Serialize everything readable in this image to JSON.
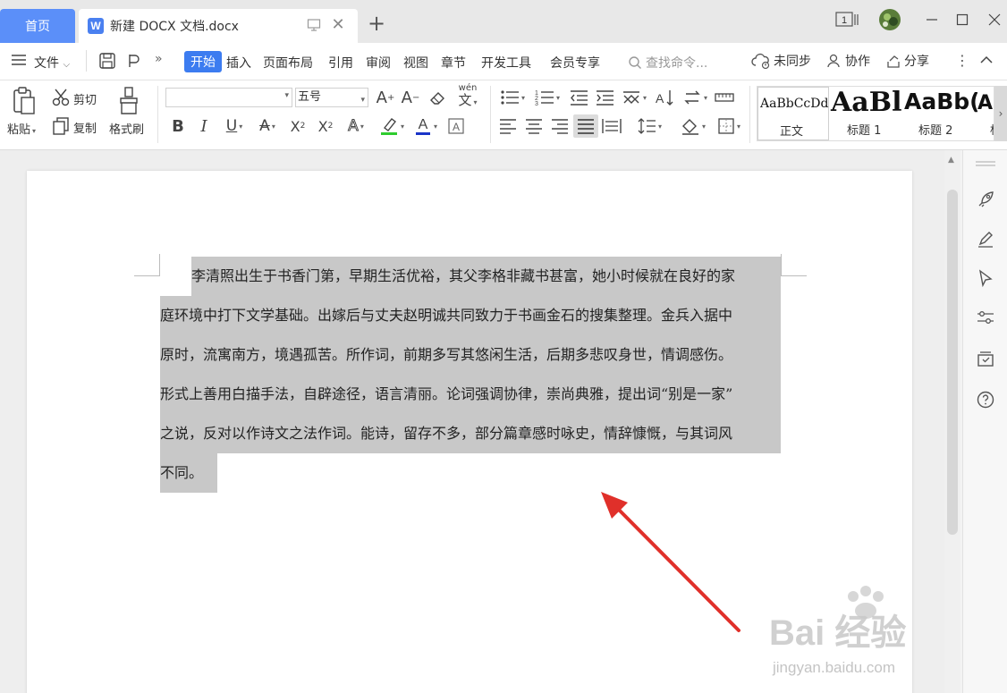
{
  "titlebar": {
    "home_tab": "首页",
    "doc_tab": "新建 DOCX 文档.docx",
    "logo_letter": "W",
    "page_indicator": "1"
  },
  "menubar": {
    "file_menu": "文件",
    "active_tab": "开始",
    "tabs": [
      "插入",
      "页面布局",
      "引用",
      "审阅",
      "视图",
      "章节",
      "开发工具",
      "会员专享"
    ],
    "search_placeholder": "查找命令...",
    "right_items": [
      "未同步",
      "协作",
      "分享"
    ]
  },
  "ribbon": {
    "paste": "粘贴",
    "cut": "剪切",
    "copy": "复制",
    "format_painter": "格式刷",
    "font_name": "",
    "font_size": "五号",
    "pinyin_glyph": "wén",
    "styles": [
      {
        "preview": "AaBbCcDd",
        "name": "正文"
      },
      {
        "preview": "AaBl",
        "name": "标题 1"
      },
      {
        "preview": "AaBb(",
        "name": "标题 2"
      },
      {
        "preview": "A",
        "name": "标"
      }
    ],
    "font_color": "#1a34c8",
    "highlight_color": "#2ecc2e"
  },
  "document": {
    "lines": [
      "李清照出生于书香门第，早期生活优裕，其父李格非藏书甚富，她小时候就在良好的家",
      "庭环境中打下文学基础。出嫁后与丈夫赵明诚共同致力于书画金石的搜集整理。金兵入据中",
      "原时，流寓南方，境遇孤苦。所作词，前期多写其悠闲生活，后期多悲叹身世，情调感伤。",
      "形式上善用白描手法，自辟途径，语言清丽。论词强调协律，崇尚典雅，提出词“别是一家”",
      "之说，反对以作诗文之法作词。能诗，留存不多，部分篇章感时咏史，情辞慷慨，与其词风",
      "不同。"
    ],
    "selection_color": "#c8c8c8"
  },
  "watermark": {
    "brand": "Bai 经验",
    "url": "jingyan.baidu.com"
  },
  "colors": {
    "accent": "#3c7cf0",
    "home_tab": "#5b8ff9",
    "arrow": "#e0302a"
  }
}
